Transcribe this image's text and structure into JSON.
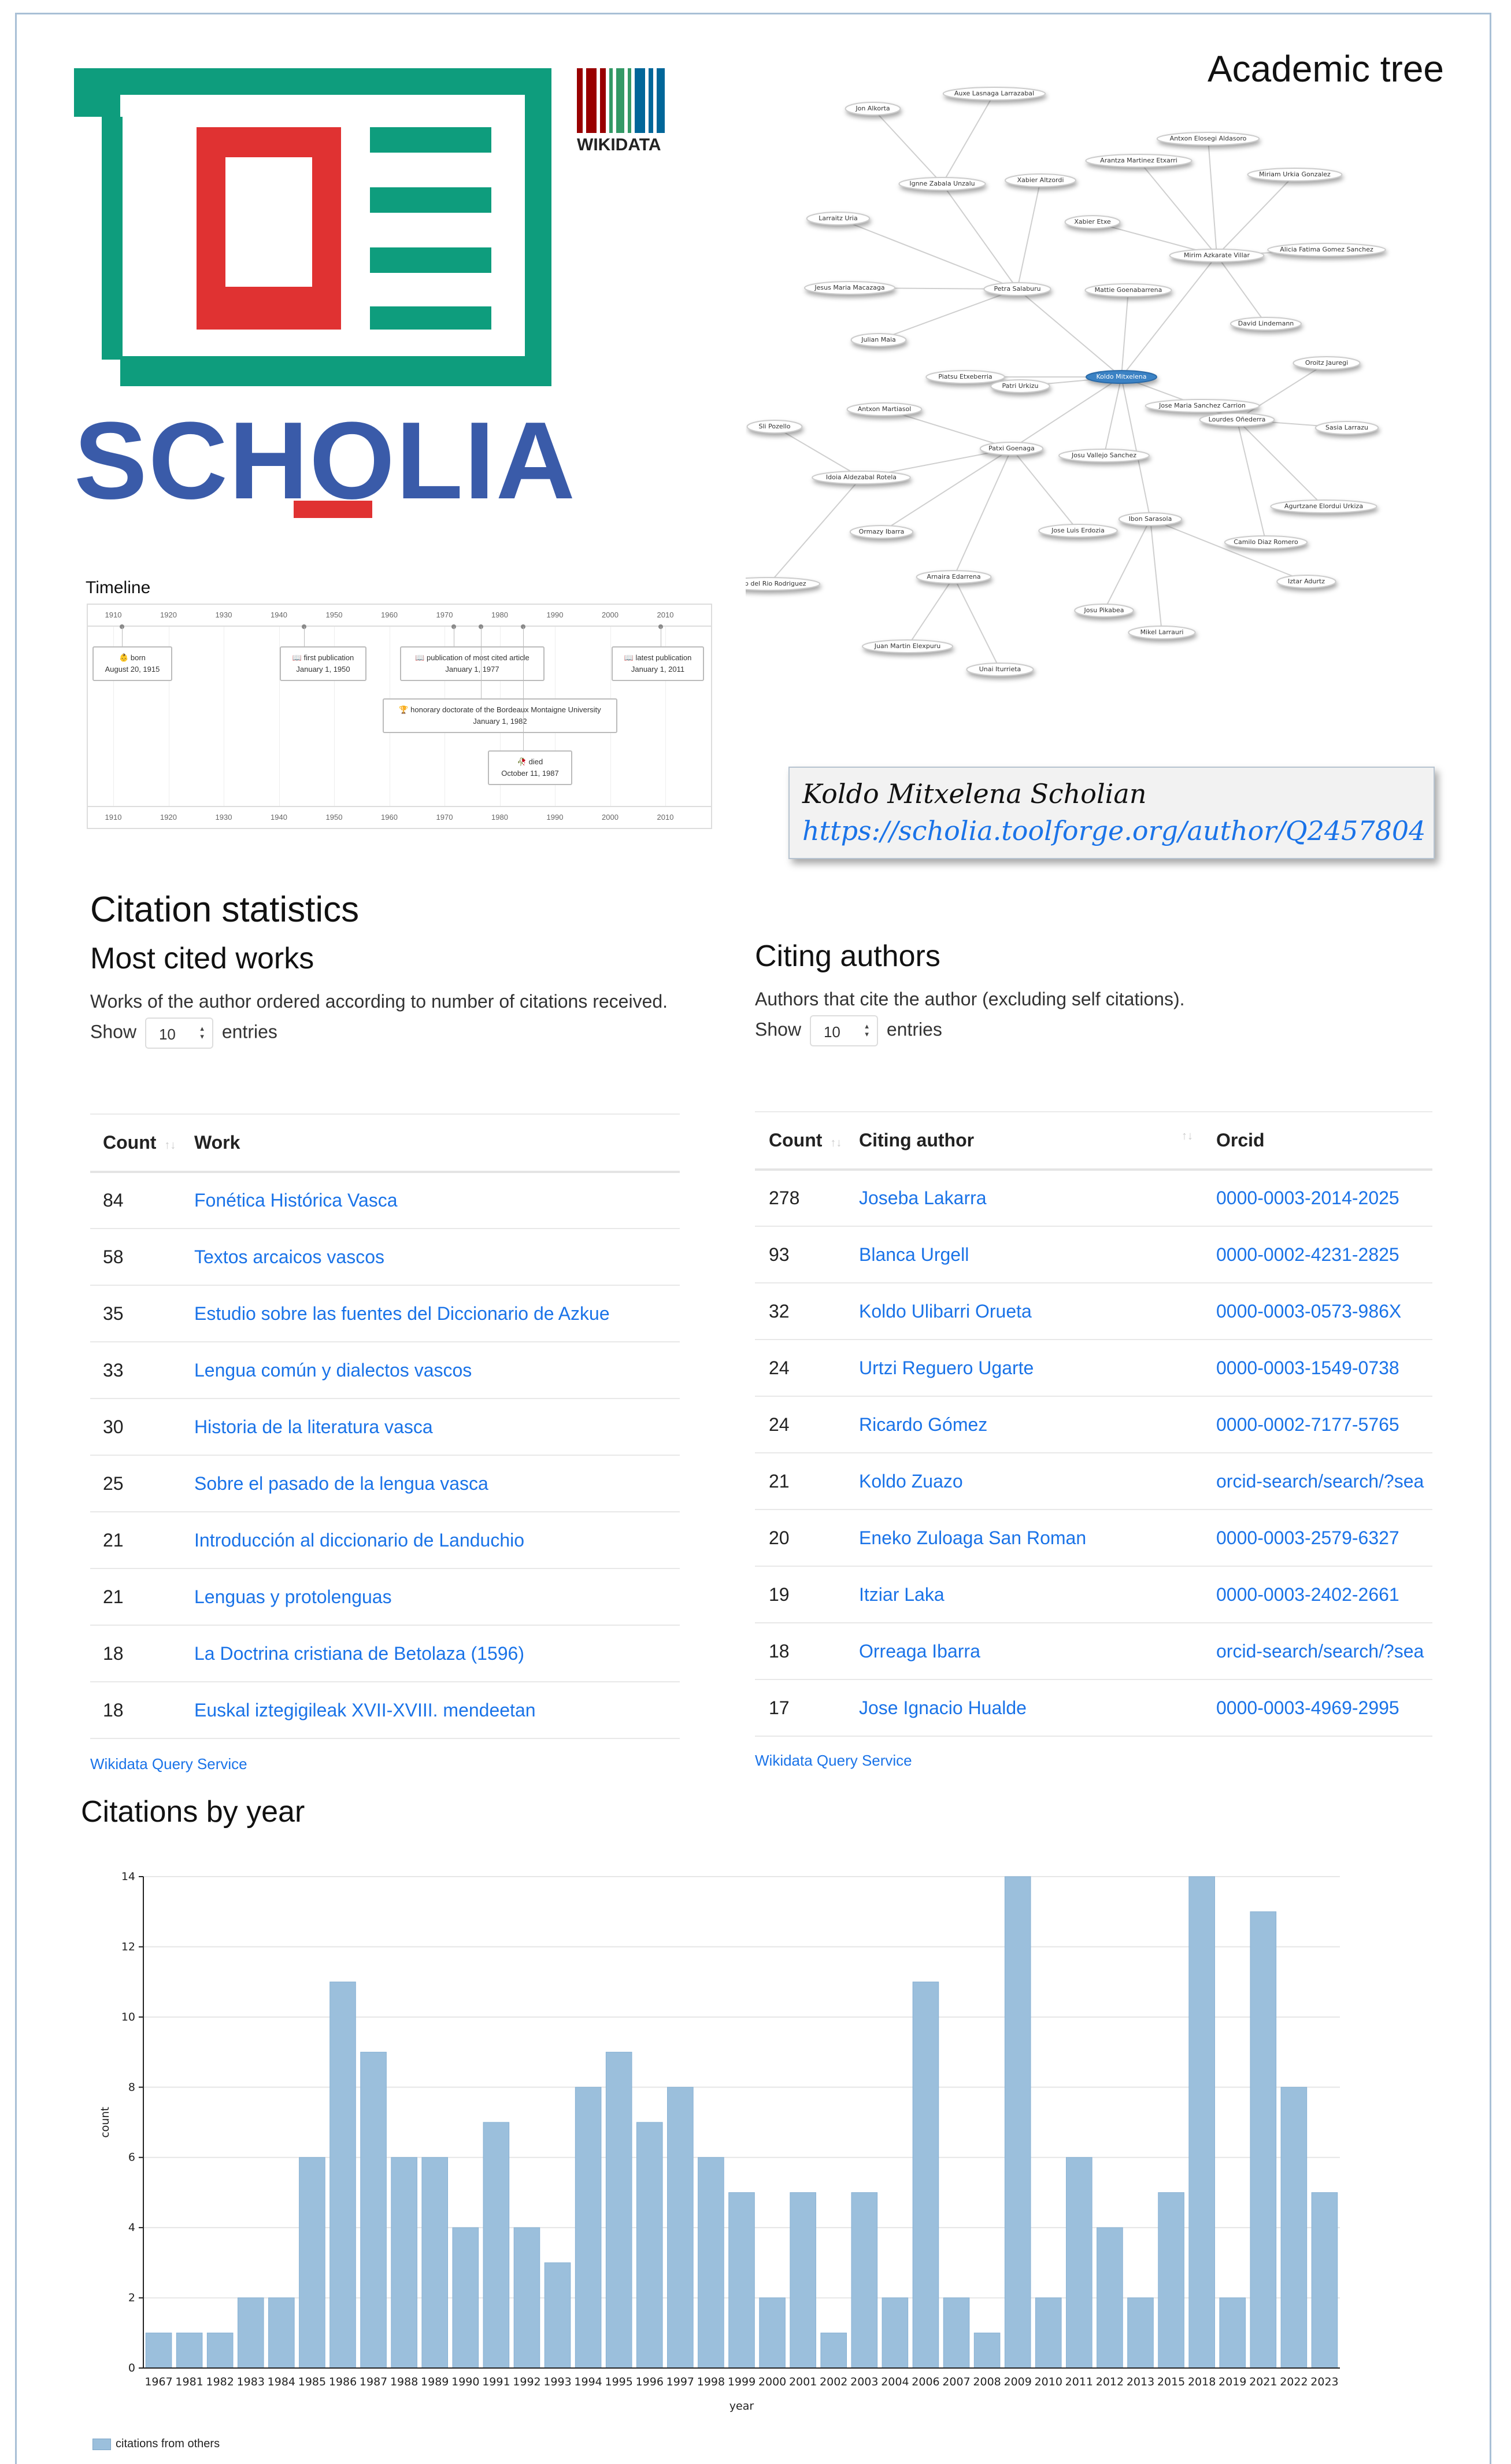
{
  "logo": {
    "brand": "SCHOLIA",
    "partner": "WIKIDATA"
  },
  "academic_tree": {
    "title": "Academic tree",
    "nodes": [
      "Jon Alkorta",
      "Auxe Lasnaga Larrazabal",
      "Ignne Zabala Unzalu",
      "Xabier Altzordi",
      "Arantza Martinez Etxarri",
      "Antxon Elosegi Aldasoro",
      "Miriam Urkia Gonzalez",
      "Larraitz Uria",
      "Xabier Etxe",
      "Mirim Azkarate Villar",
      "Alicia Fatima Gomez Sanchez",
      "Jesus Maria Macazaga",
      "Petra Salaburu",
      "Mattie Goenabarrena",
      "David Lindemann",
      "Julian Maia",
      "Piatsu Etxeberria",
      "Patri Urkizu",
      "Koldo Mitxelena",
      "Oroitz Jauregi",
      "Antxon Martiasol",
      "Jose Maria Sanchez Carrion",
      "Lourdes Oñederra",
      "Sasia Larrazu",
      "Sli Pozello",
      "Patxi Goenaga",
      "Josu Vallejo Sanchez",
      "Idoia Aldezabal Rotela",
      "Agurtzane Elordui Urkiza",
      "Ormazy Ibarra",
      "Jose Luis Erdozia",
      "Ibon Sarasola",
      "Camilo Diaz Romero",
      "Arnaira Edarrena",
      "Iztar Adurtz",
      "Josu Pikabea",
      "Mikel Larrauri",
      "Juan Martin Elexpuru",
      "Unai Iturrieta",
      "Josep del Rio Rodriguez"
    ]
  },
  "timeline": {
    "label": "Timeline",
    "years": [
      "1910",
      "1920",
      "1930",
      "1940",
      "1950",
      "1960",
      "1970",
      "1980",
      "1990",
      "2000",
      "2010"
    ],
    "events": [
      {
        "icon": "👶",
        "title": "born",
        "date": "August 20, 1915"
      },
      {
        "icon": "📖",
        "title": "first publication",
        "date": "January 1, 1950"
      },
      {
        "icon": "📖",
        "title": "publication of most cited article",
        "date": "January 1, 1977"
      },
      {
        "icon": "📖",
        "title": "latest publication",
        "date": "January 1, 2011"
      },
      {
        "icon": "🏆",
        "title": "honorary doctorate of the Bordeaux Montaigne University",
        "date": "January 1, 1982"
      },
      {
        "icon": "🥀",
        "title": "died",
        "date": "October 11, 1987"
      }
    ]
  },
  "scholian": {
    "title": "Koldo Mitxelena Scholian",
    "url": "https://scholia.toolforge.org/author/Q2457804"
  },
  "citation_stats": {
    "title": "Citation statistics",
    "show_label": "Show",
    "entries_label": "entries",
    "entries_value": "10",
    "wqs_label": "Wikidata Query Service",
    "most_cited": {
      "title": "Most cited works",
      "description": "Works of the author ordered according to number of citations received.",
      "columns": [
        "Count",
        "Work"
      ],
      "rows": [
        {
          "count": "84",
          "work": "Fonética Histórica Vasca"
        },
        {
          "count": "58",
          "work": "Textos arcaicos vascos"
        },
        {
          "count": "35",
          "work": "Estudio sobre las fuentes del Diccionario de Azkue"
        },
        {
          "count": "33",
          "work": "Lengua común y dialectos vascos"
        },
        {
          "count": "30",
          "work": "Historia de la literatura vasca"
        },
        {
          "count": "25",
          "work": "Sobre el pasado de la lengua vasca"
        },
        {
          "count": "21",
          "work": "Introducción al diccionario de Landuchio"
        },
        {
          "count": "21",
          "work": "Lenguas y protolenguas"
        },
        {
          "count": "18",
          "work": "La Doctrina cristiana de Betolaza (1596)"
        },
        {
          "count": "18",
          "work": "Euskal iztegigileak XVII-XVIII. mendeetan"
        }
      ]
    },
    "citing_authors": {
      "title": "Citing authors",
      "description": "Authors that cite the author (excluding self citations).",
      "columns": [
        "Count",
        "Citing author",
        "Orcid"
      ],
      "rows": [
        {
          "count": "278",
          "author": "Joseba Lakarra",
          "orcid": "0000-0003-2014-2025"
        },
        {
          "count": "93",
          "author": "Blanca Urgell",
          "orcid": "0000-0002-4231-2825"
        },
        {
          "count": "32",
          "author": "Koldo Ulibarri Orueta",
          "orcid": "0000-0003-0573-986X"
        },
        {
          "count": "24",
          "author": "Urtzi Reguero Ugarte",
          "orcid": "0000-0003-1549-0738"
        },
        {
          "count": "24",
          "author": "Ricardo Gómez",
          "orcid": "0000-0002-7177-5765"
        },
        {
          "count": "21",
          "author": "Koldo Zuazo",
          "orcid": "orcid-search/search/?sea"
        },
        {
          "count": "20",
          "author": "Eneko Zuloaga San Roman",
          "orcid": "0000-0003-2579-6327"
        },
        {
          "count": "19",
          "author": "Itziar Laka",
          "orcid": "0000-0003-2402-2661"
        },
        {
          "count": "18",
          "author": "Orreaga Ibarra",
          "orcid": "orcid-search/search/?sea"
        },
        {
          "count": "17",
          "author": "Jose Ignacio Hualde",
          "orcid": "0000-0003-4969-2995"
        }
      ]
    }
  },
  "citations_by_year": {
    "title": "Citations by year"
  },
  "chart_data": {
    "type": "bar",
    "title": "Citations by year",
    "xlabel": "year",
    "ylabel": "count",
    "ylim": [
      0,
      14
    ],
    "yticks": [
      0,
      2,
      4,
      6,
      8,
      10,
      12,
      14
    ],
    "grid": true,
    "legend_position": "bottom-left",
    "color": "#9bbfdc",
    "categories": [
      "1967",
      "1981",
      "1982",
      "1983",
      "1984",
      "1985",
      "1986",
      "1987",
      "1988",
      "1989",
      "1990",
      "1991",
      "1992",
      "1993",
      "1994",
      "1995",
      "1996",
      "1997",
      "1998",
      "1999",
      "2000",
      "2001",
      "2002",
      "2003",
      "2004",
      "2006",
      "2007",
      "2008",
      "2009",
      "2010",
      "2011",
      "2012",
      "2013",
      "2015",
      "2018",
      "2019",
      "2021",
      "2022",
      "2023"
    ],
    "series": [
      {
        "name": "citations from others",
        "values": [
          1,
          1,
          1,
          2,
          2,
          6,
          11,
          9,
          6,
          6,
          4,
          7,
          4,
          3,
          8,
          9,
          7,
          8,
          6,
          5,
          2,
          5,
          1,
          5,
          2,
          11,
          2,
          1,
          14,
          2,
          6,
          4,
          2,
          5,
          14,
          2,
          13,
          8,
          5
        ]
      }
    ]
  }
}
